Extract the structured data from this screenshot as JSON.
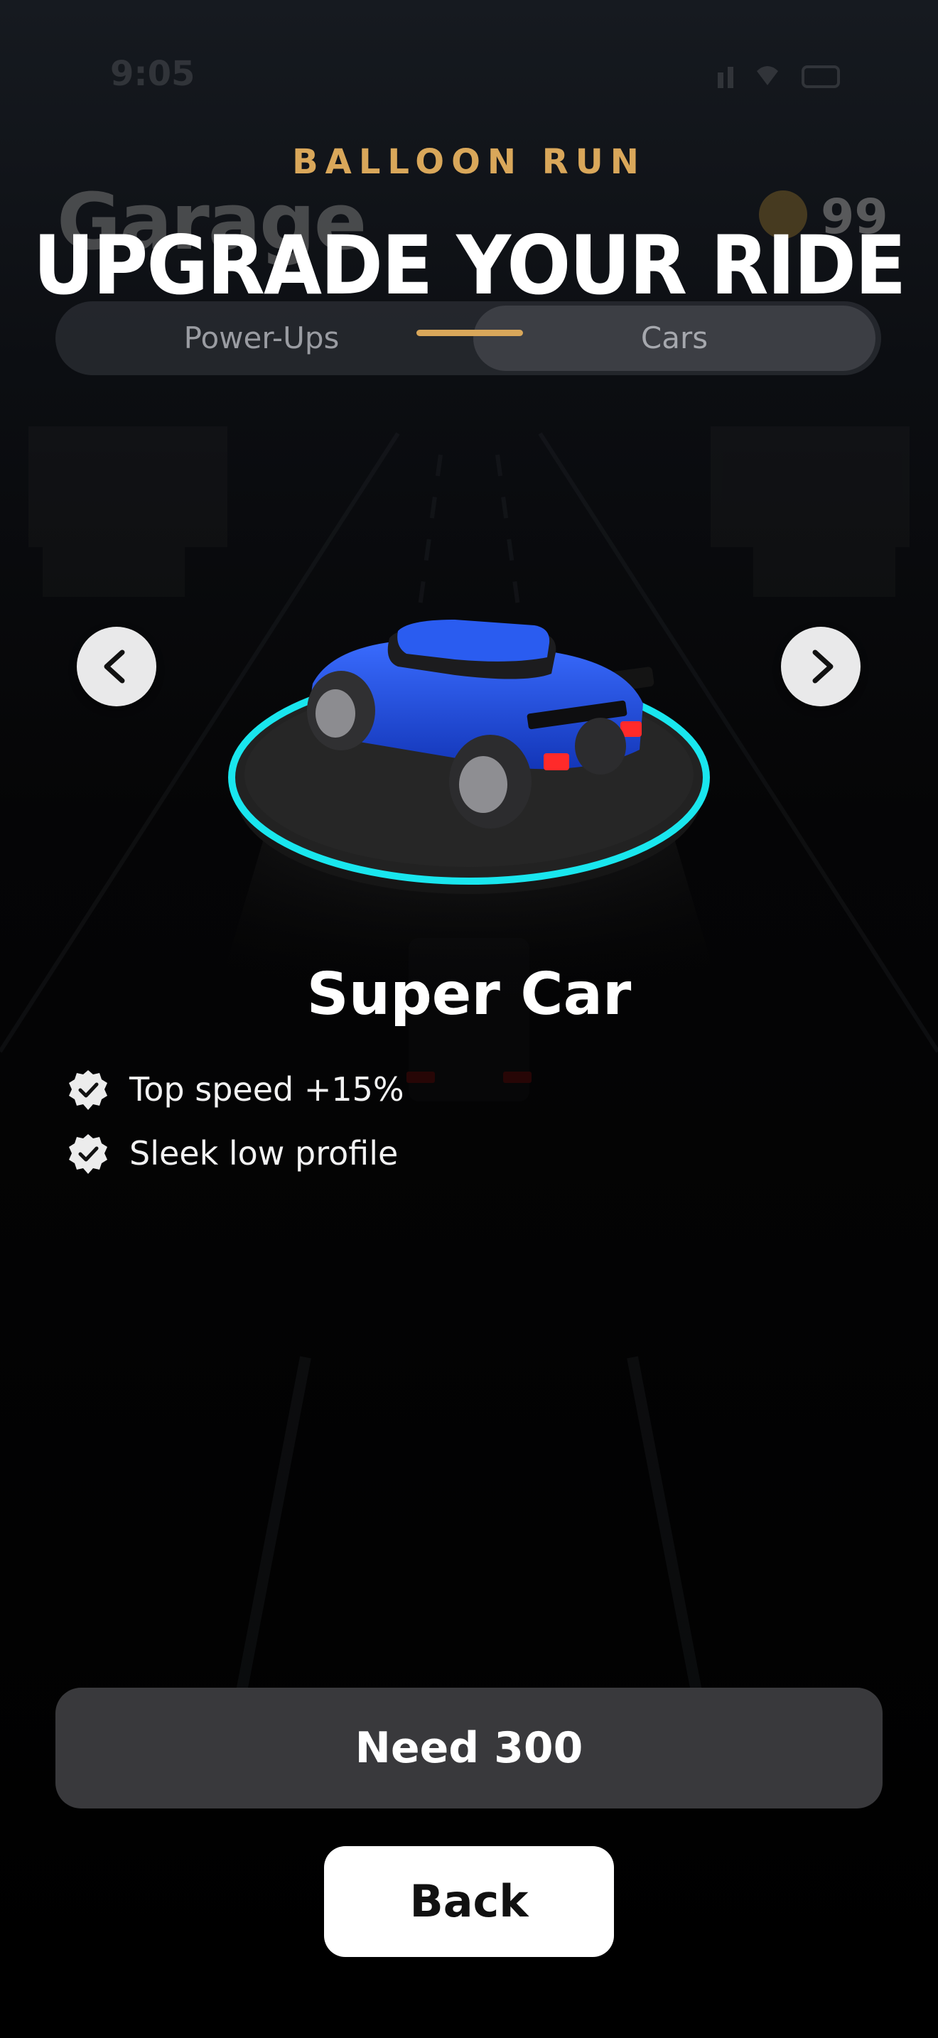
{
  "status_bar": {
    "time": "9:05",
    "icons": "signal-icon wifi-icon battery-icon"
  },
  "header": {
    "brand": "BALLOON RUN",
    "garage_title": "Garage",
    "coin_count": "99",
    "headline": "UPGRADE YOUR RIDE"
  },
  "tabs": [
    {
      "label": "Power-Ups",
      "selected": false
    },
    {
      "label": "Cars",
      "selected": true
    }
  ],
  "car": {
    "name": "Super Car",
    "body_color": "#1f4fd8",
    "ring_color": "#19e6ee",
    "features": [
      "Top speed +15%",
      "Sleek low profile"
    ]
  },
  "actions": {
    "need": "Need 300",
    "back": "Back"
  },
  "colors": {
    "accent": "#d9a75a",
    "button_dark": "#39393c"
  }
}
